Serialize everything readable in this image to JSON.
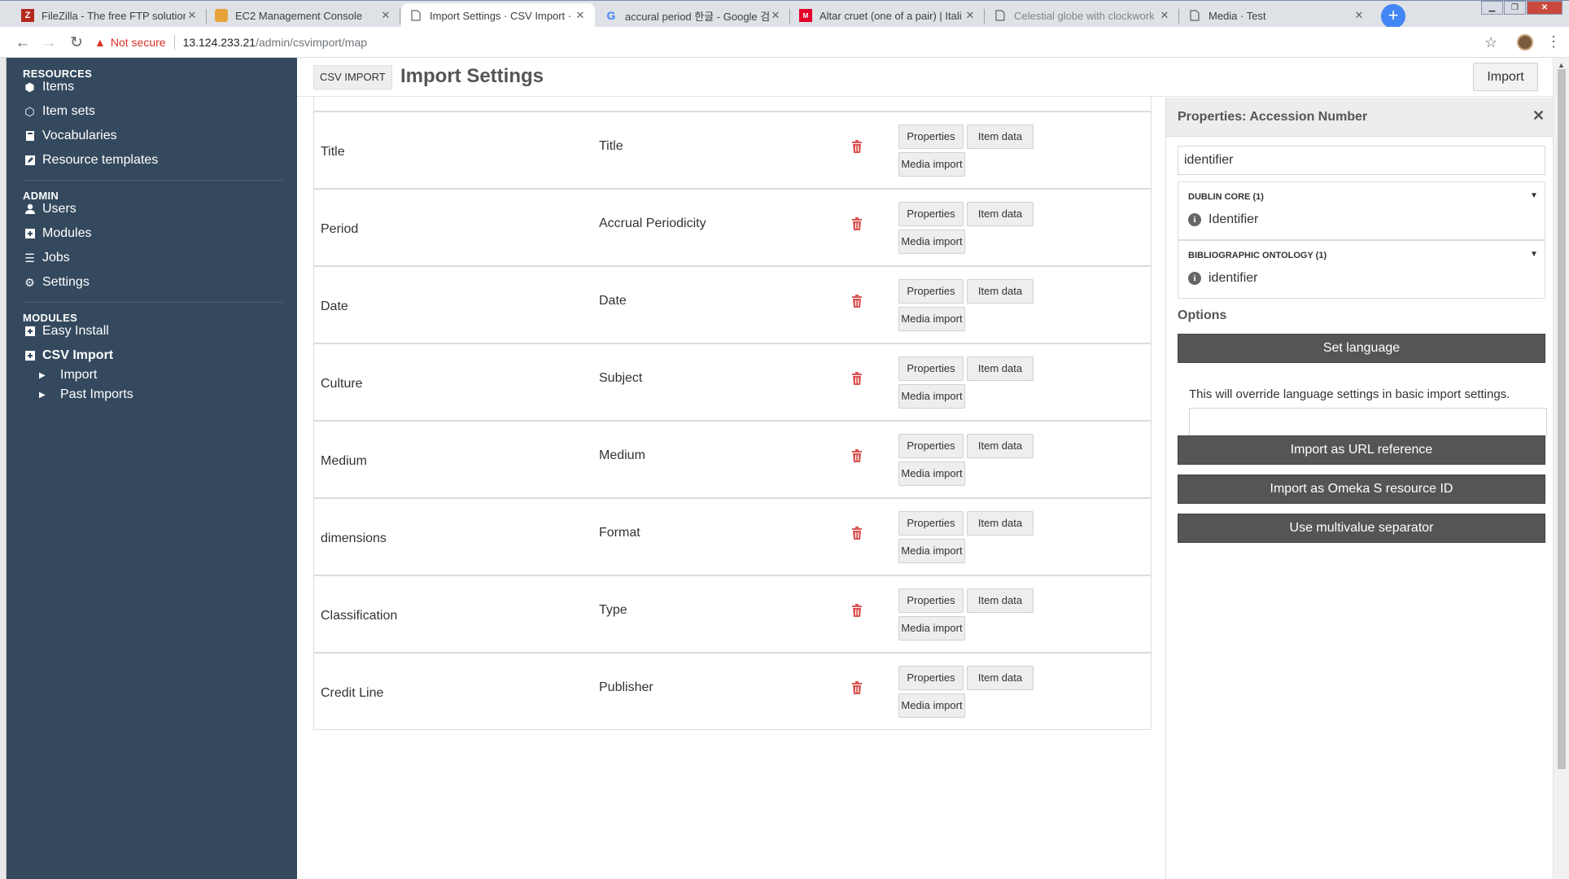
{
  "browser": {
    "tabs": [
      {
        "title": "FileZilla - The free FTP solution",
        "icon": "filezilla-icon"
      },
      {
        "title": "EC2 Management Console",
        "icon": "aws-icon"
      },
      {
        "title": "Import Settings · CSV Import · t",
        "icon": "page-icon"
      },
      {
        "title": "accural period 한글 - Google 검",
        "icon": "google-icon"
      },
      {
        "title": "Altar cruet (one of a pair) | Itali",
        "icon": "met-icon"
      },
      {
        "title": "Celestial globe with clockwork",
        "icon": "page-icon"
      },
      {
        "title": "Media · Test",
        "icon": "page-icon"
      }
    ],
    "security_label": "Not secure",
    "url_host": "13.124.233.21",
    "url_path": "/admin/csvimport/map"
  },
  "sidebar": {
    "resources_heading": "RESOURCES",
    "resources": [
      {
        "label": "Items",
        "icon": "cube-icon"
      },
      {
        "label": "Item sets",
        "icon": "cubes-icon"
      },
      {
        "label": "Vocabularies",
        "icon": "book-icon"
      },
      {
        "label": "Resource templates",
        "icon": "pencil-square-icon"
      }
    ],
    "admin_heading": "ADMIN",
    "admin": [
      {
        "label": "Users",
        "icon": "user-icon"
      },
      {
        "label": "Modules",
        "icon": "plus-square-icon"
      },
      {
        "label": "Jobs",
        "icon": "list-icon"
      },
      {
        "label": "Settings",
        "icon": "cogs-icon"
      }
    ],
    "modules_heading": "MODULES",
    "modules": [
      {
        "label": "Easy Install",
        "icon": "plus-square-icon"
      },
      {
        "label": "CSV Import",
        "icon": "plus-square-icon"
      }
    ],
    "csv_sub": [
      {
        "label": "Import"
      },
      {
        "label": "Past Imports"
      }
    ]
  },
  "header": {
    "breadcrumb": "CSV IMPORT",
    "title": "Import Settings",
    "import_button": "Import"
  },
  "mapping": {
    "btn_properties": "Properties",
    "btn_item_data": "Item data",
    "btn_media_import": "Media import",
    "rows": [
      {
        "column": "Title",
        "property": "Title"
      },
      {
        "column": "Period",
        "property": "Accrual Periodicity"
      },
      {
        "column": "Date",
        "property": "Date"
      },
      {
        "column": "Culture",
        "property": "Subject"
      },
      {
        "column": "Medium",
        "property": "Medium"
      },
      {
        "column": "dimensions",
        "property": "Format"
      },
      {
        "column": "Classification",
        "property": "Type"
      },
      {
        "column": "Credit Line",
        "property": "Publisher"
      }
    ]
  },
  "panel": {
    "title": "Properties: Accession Number",
    "search_value": "identifier",
    "vocabularies": [
      {
        "name": "DUBLIN CORE (1)",
        "item": "Identifier"
      },
      {
        "name": "BIBLIOGRAPHIC ONTOLOGY (1)",
        "item": "identifier"
      }
    ],
    "options_heading": "Options",
    "set_language": "Set language",
    "language_note": "This will override language settings in basic import settings.",
    "url_reference": "Import as URL reference",
    "resource_id": "Import as Omeka S resource ID",
    "multivalue": "Use multivalue separator"
  },
  "colors": {
    "sidebar_bg": "#34495e",
    "option_button_bg": "#555555",
    "trash_red": "#d9534f"
  }
}
